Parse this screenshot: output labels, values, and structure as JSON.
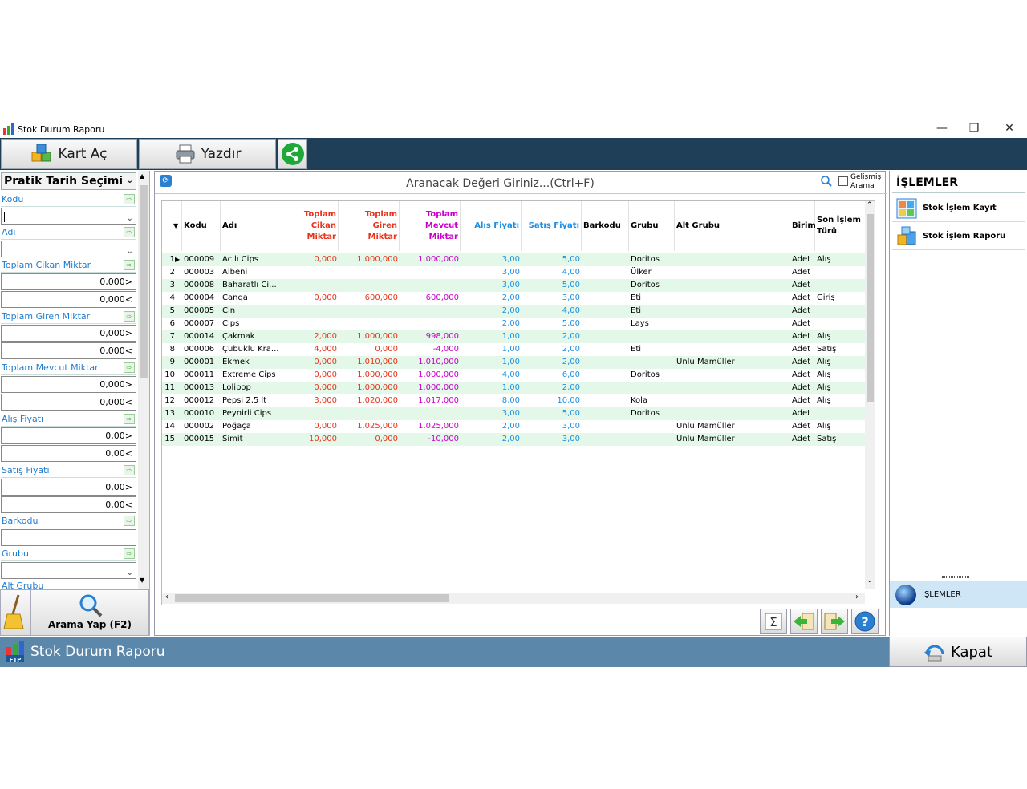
{
  "window": {
    "title": "Stok Durum Raporu",
    "controls": [
      "—",
      "❐",
      "✕"
    ]
  },
  "toolbar": {
    "kart_ac": "Kart Aç",
    "yazdir": "Yazdır"
  },
  "left_panel": {
    "header": "Pratik Tarih Seçimi",
    "fields": [
      {
        "label": "Kodu",
        "inputs": [
          ""
        ]
      },
      {
        "label": "Adı",
        "inputs": [
          ""
        ]
      },
      {
        "label": "Toplam Cikan Miktar",
        "inputs": [
          "0,000>",
          "0,000<"
        ]
      },
      {
        "label": "Toplam Giren Miktar",
        "inputs": [
          "0,000>",
          "0,000<"
        ]
      },
      {
        "label": "Toplam Mevcut Miktar",
        "inputs": [
          "0,000>",
          "0,000<"
        ]
      },
      {
        "label": "Alış Fiyatı",
        "inputs": [
          "0,00>",
          "0,00<"
        ]
      },
      {
        "label": "Satış Fiyatı",
        "inputs": [
          "0,00>",
          "0,00<"
        ]
      },
      {
        "label": "Barkodu",
        "inputs": [
          ""
        ]
      },
      {
        "label": "Grubu",
        "inputs": [
          ""
        ]
      },
      {
        "label": "Alt Grubu",
        "inputs": []
      }
    ],
    "search_button": "Arama Yap (F2)"
  },
  "search": {
    "placeholder": "Aranacak Değeri Giriniz...(Ctrl+F)",
    "advanced_label_1": "Gelişmiş",
    "advanced_label_2": "Arama"
  },
  "grid": {
    "headers": {
      "kodu": "Kodu",
      "adi": "Adı",
      "cikan_1": "Toplam Cikan",
      "cikan_2": "Miktar",
      "giren_1": "Toplam Giren",
      "giren_2": "Miktar",
      "mevcut_1": "Toplam",
      "mevcut_2": "Mevcut",
      "mevcut_3": "Miktar",
      "alis": "Alış Fiyatı",
      "satis": "Satış Fiyatı",
      "barkodu": "Barkodu",
      "grubu": "Grubu",
      "alt_grubu": "Alt Grubu",
      "birim": "Birim",
      "son_islem_1": "Son İşlem",
      "son_islem_2": "Türü"
    },
    "rows": [
      {
        "no": "1",
        "kodu": "000009",
        "adi": "Acılı Cips",
        "cikan": "0,000",
        "giren": "1.000,000",
        "mevcut": "1.000,000",
        "alis": "3,00",
        "satis": "5,00",
        "barkodu": "",
        "grubu": "Doritos",
        "alt": "",
        "birim": "Adet",
        "son": "Alış"
      },
      {
        "no": "2",
        "kodu": "000003",
        "adi": "Albeni",
        "cikan": "",
        "giren": "",
        "mevcut": "",
        "alis": "3,00",
        "satis": "4,00",
        "barkodu": "",
        "grubu": "Ülker",
        "alt": "",
        "birim": "Adet",
        "son": ""
      },
      {
        "no": "3",
        "kodu": "000008",
        "adi": "Baharatlı Ci...",
        "cikan": "",
        "giren": "",
        "mevcut": "",
        "alis": "3,00",
        "satis": "5,00",
        "barkodu": "",
        "grubu": "Doritos",
        "alt": "",
        "birim": "Adet",
        "son": ""
      },
      {
        "no": "4",
        "kodu": "000004",
        "adi": "Canga",
        "cikan": "0,000",
        "giren": "600,000",
        "mevcut": "600,000",
        "alis": "2,00",
        "satis": "3,00",
        "barkodu": "",
        "grubu": "Eti",
        "alt": "",
        "birim": "Adet",
        "son": "Giriş"
      },
      {
        "no": "5",
        "kodu": "000005",
        "adi": "Cin",
        "cikan": "",
        "giren": "",
        "mevcut": "",
        "alis": "2,00",
        "satis": "4,00",
        "barkodu": "",
        "grubu": "Eti",
        "alt": "",
        "birim": "Adet",
        "son": ""
      },
      {
        "no": "6",
        "kodu": "000007",
        "adi": "Cips",
        "cikan": "",
        "giren": "",
        "mevcut": "",
        "alis": "2,00",
        "satis": "5,00",
        "barkodu": "",
        "grubu": "Lays",
        "alt": "",
        "birim": "Adet",
        "son": ""
      },
      {
        "no": "7",
        "kodu": "000014",
        "adi": "Çakmak",
        "cikan": "2,000",
        "giren": "1.000,000",
        "mevcut": "998,000",
        "alis": "1,00",
        "satis": "2,00",
        "barkodu": "",
        "grubu": "",
        "alt": "",
        "birim": "Adet",
        "son": "Alış"
      },
      {
        "no": "8",
        "kodu": "000006",
        "adi": "Çubuklu Kra...",
        "cikan": "4,000",
        "giren": "0,000",
        "mevcut": "-4,000",
        "alis": "1,00",
        "satis": "2,00",
        "barkodu": "",
        "grubu": "Eti",
        "alt": "",
        "birim": "Adet",
        "son": "Satış"
      },
      {
        "no": "9",
        "kodu": "000001",
        "adi": "Ekmek",
        "cikan": "0,000",
        "giren": "1.010,000",
        "mevcut": "1.010,000",
        "alis": "1,00",
        "satis": "2,00",
        "barkodu": "",
        "grubu": "",
        "alt": "Unlu Mamüller",
        "birim": "Adet",
        "son": "Alış"
      },
      {
        "no": "10",
        "kodu": "000011",
        "adi": "Extreme Cips",
        "cikan": "0,000",
        "giren": "1.000,000",
        "mevcut": "1.000,000",
        "alis": "4,00",
        "satis": "6,00",
        "barkodu": "",
        "grubu": "Doritos",
        "alt": "",
        "birim": "Adet",
        "son": "Alış"
      },
      {
        "no": "11",
        "kodu": "000013",
        "adi": "Lolipop",
        "cikan": "0,000",
        "giren": "1.000,000",
        "mevcut": "1.000,000",
        "alis": "1,00",
        "satis": "2,00",
        "barkodu": "",
        "grubu": "",
        "alt": "",
        "birim": "Adet",
        "son": "Alış"
      },
      {
        "no": "12",
        "kodu": "000012",
        "adi": "Pepsi 2,5 lt",
        "cikan": "3,000",
        "giren": "1.020,000",
        "mevcut": "1.017,000",
        "alis": "8,00",
        "satis": "10,00",
        "barkodu": "",
        "grubu": "Kola",
        "alt": "",
        "birim": "Adet",
        "son": "Alış"
      },
      {
        "no": "13",
        "kodu": "000010",
        "adi": "Peynirli Cips",
        "cikan": "",
        "giren": "",
        "mevcut": "",
        "alis": "3,00",
        "satis": "5,00",
        "barkodu": "",
        "grubu": "Doritos",
        "alt": "",
        "birim": "Adet",
        "son": ""
      },
      {
        "no": "14",
        "kodu": "000002",
        "adi": "Poğaça",
        "cikan": "0,000",
        "giren": "1.025,000",
        "mevcut": "1.025,000",
        "alis": "2,00",
        "satis": "3,00",
        "barkodu": "",
        "grubu": "",
        "alt": "Unlu Mamüller",
        "birim": "Adet",
        "son": "Alış"
      },
      {
        "no": "15",
        "kodu": "000015",
        "adi": "Simit",
        "cikan": "10,000",
        "giren": "0,000",
        "mevcut": "-10,000",
        "alis": "2,00",
        "satis": "3,00",
        "barkodu": "",
        "grubu": "",
        "alt": "Unlu Mamüller",
        "birim": "Adet",
        "son": "Satış"
      }
    ]
  },
  "right_panel": {
    "header": "İŞLEMLER",
    "items": [
      "Stok İşlem Kayıt",
      "Stok İşlem Raporu"
    ],
    "bottom_item": "İŞLEMLER"
  },
  "status_bar": {
    "title": "Stok Durum Raporu",
    "close_label": "Kapat"
  },
  "colors": {
    "row_green": "#e3f8e8",
    "cikan_giren": "#e8341c",
    "mevcut": "#cc00cc",
    "price": "#1e8fe0",
    "toolbar_bg": "#1f3e57",
    "status_bg": "#5a87aa"
  }
}
